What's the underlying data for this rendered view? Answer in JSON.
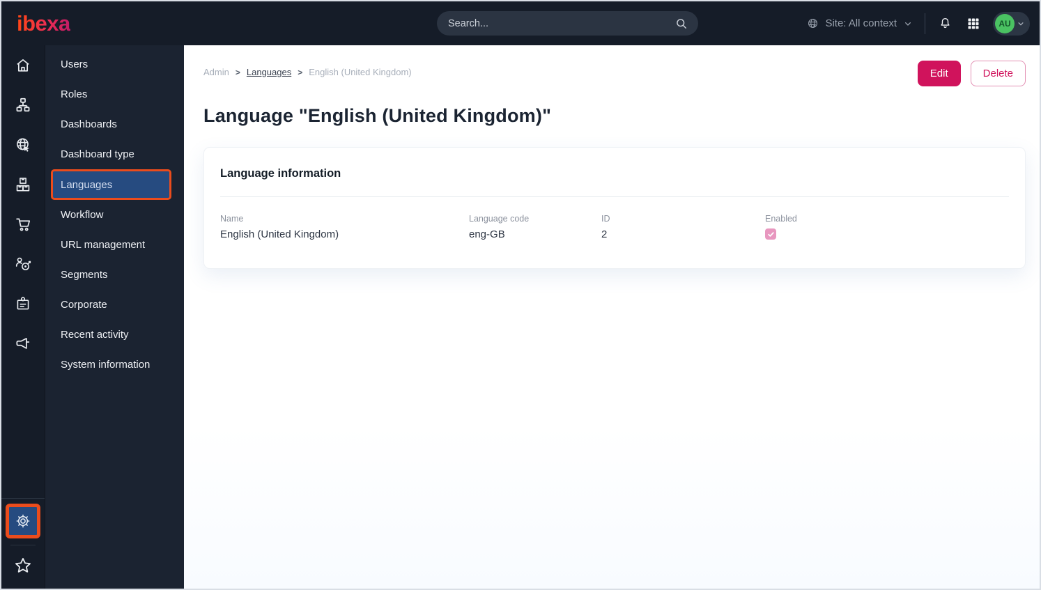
{
  "topbar": {
    "logo": "ibexa",
    "search_placeholder": "Search...",
    "site_context_label": "Site: All context",
    "avatar_initials": "AU"
  },
  "icon_rail": {
    "items": [
      "home-icon",
      "content-tree-icon",
      "site-globe-icon",
      "product-boxes-icon",
      "commerce-cart-icon",
      "personalization-target-icon",
      "corporate-badge-icon",
      "marketing-megaphone-icon"
    ],
    "bottom_items": [
      "settings-gear-icon",
      "bookmarks-star-icon"
    ],
    "highlighted": "settings-gear-icon"
  },
  "sidebar": {
    "items": [
      "Users",
      "Roles",
      "Dashboards",
      "Dashboard type",
      "Languages",
      "Workflow",
      "URL management",
      "Segments",
      "Corporate",
      "Recent activity",
      "System information"
    ],
    "selected": "Languages",
    "selected_index": 4
  },
  "breadcrumb": {
    "items": [
      "Admin",
      "Languages",
      "English (United Kingdom)"
    ]
  },
  "actions": {
    "edit_label": "Edit",
    "delete_label": "Delete"
  },
  "page_title": "Language \"English (United Kingdom)\"",
  "card": {
    "title": "Language information",
    "fields": [
      {
        "label": "Name",
        "value": "English (United Kingdom)"
      },
      {
        "label": "Language code",
        "value": "eng-GB"
      },
      {
        "label": "ID",
        "value": "2"
      },
      {
        "label": "Enabled",
        "checked": true
      }
    ]
  },
  "colors": {
    "accent_pink": "#d0135c",
    "selected_blue": "#264b80",
    "annotation_orange": "#eb4c1c",
    "topbar_bg": "#151c28",
    "avatar_green": "#4ac262",
    "checkbox_pink": "#e897bf"
  }
}
